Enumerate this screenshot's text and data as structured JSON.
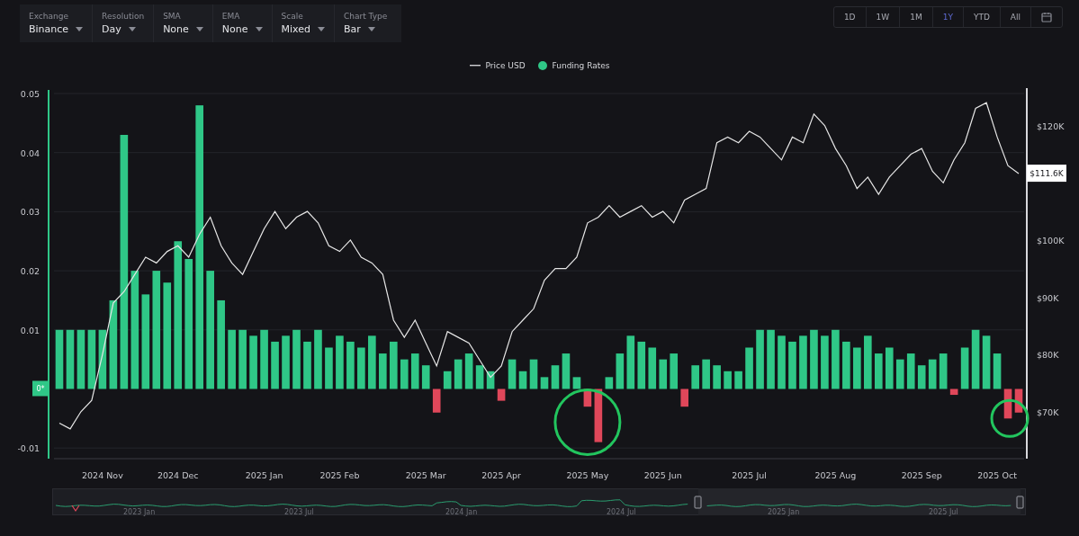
{
  "toolbar": {
    "selectors": [
      {
        "label": "Exchange",
        "value": "Binance"
      },
      {
        "label": "Resolution",
        "value": "Day"
      },
      {
        "label": "SMA",
        "value": "None"
      },
      {
        "label": "EMA",
        "value": "None"
      },
      {
        "label": "Scale",
        "value": "Mixed"
      },
      {
        "label": "Chart Type",
        "value": "Bar"
      }
    ]
  },
  "range_buttons": [
    {
      "label": "1D",
      "selected": false
    },
    {
      "label": "1W",
      "selected": false
    },
    {
      "label": "1M",
      "selected": false
    },
    {
      "label": "1Y",
      "selected": true
    },
    {
      "label": "YTD",
      "selected": false
    },
    {
      "label": "All",
      "selected": false
    }
  ],
  "chart": {
    "zero_badge": "0*",
    "price_tag": "$111.6K",
    "chart_data": {
      "type": "bar",
      "ylim": [
        -0.0118,
        0.05
      ],
      "y2lim": [
        61.8,
        125.6
      ],
      "yticks": [
        {
          "value": 0.05,
          "label": "0.05"
        },
        {
          "value": 0.04,
          "label": "0.04"
        },
        {
          "value": 0.03,
          "label": "0.03"
        },
        {
          "value": 0.02,
          "label": "0.02"
        },
        {
          "value": 0.01,
          "label": "0.01"
        },
        {
          "value": -0.01,
          "label": "-0.01"
        }
      ],
      "y2ticks": [
        {
          "value": 120,
          "label": "$120K"
        },
        {
          "value": 100,
          "label": "$100K"
        },
        {
          "value": 90,
          "label": "$90K"
        },
        {
          "value": 80,
          "label": "$80K"
        },
        {
          "value": 70,
          "label": "$70K"
        }
      ],
      "categories": [
        null,
        null,
        null,
        null,
        "2024 Nov",
        null,
        null,
        null,
        null,
        null,
        null,
        "2024 Dec",
        null,
        null,
        null,
        null,
        null,
        null,
        null,
        "2025 Jan",
        null,
        null,
        null,
        null,
        null,
        null,
        "2025 Feb",
        null,
        null,
        null,
        null,
        null,
        null,
        null,
        "2025 Mar",
        null,
        null,
        null,
        null,
        null,
        null,
        "2025 Apr",
        null,
        null,
        null,
        null,
        null,
        null,
        null,
        "2025 May",
        null,
        null,
        null,
        null,
        null,
        null,
        "2025 Jun",
        null,
        null,
        null,
        null,
        null,
        null,
        null,
        "2025 Jul",
        null,
        null,
        null,
        null,
        null,
        null,
        null,
        "2025 Aug",
        null,
        null,
        null,
        null,
        null,
        null,
        null,
        "2025 Sep",
        null,
        null,
        null,
        null,
        null,
        null,
        "2025 Oct",
        null,
        null
      ],
      "grid": true,
      "series": [
        {
          "name": "Price USD",
          "type": "line",
          "axis": "y2",
          "color": "#e6e6e6",
          "values": [
            68,
            67,
            70,
            72,
            80,
            89,
            91,
            94,
            97,
            96,
            98,
            99,
            97,
            101,
            104,
            99,
            96,
            94,
            98,
            102,
            105,
            102,
            104,
            105,
            103,
            99,
            98,
            100,
            97,
            96,
            94,
            86,
            83,
            86,
            82,
            78,
            84,
            83,
            82,
            79,
            76,
            78,
            84,
            86,
            88,
            93,
            95,
            95,
            97,
            103,
            104,
            106,
            104,
            105,
            106,
            104,
            105,
            103,
            107,
            108,
            109,
            117,
            118,
            117,
            119,
            118,
            116,
            114,
            118,
            117,
            122,
            120,
            116,
            113,
            109,
            111,
            108,
            111,
            113,
            115,
            116,
            112,
            110,
            114,
            117,
            123,
            124,
            118,
            113,
            111.6
          ]
        },
        {
          "name": "Funding Rates",
          "type": "bar",
          "color": "#2fc787",
          "colors": [
            "#2fc787",
            "#2fc787",
            "#2fc787",
            "#2fc787",
            "#2fc787",
            "#2fc787",
            "#2fc787",
            "#2fc787",
            "#2fc787",
            "#2fc787",
            "#2fc787",
            "#2fc787",
            "#2fc787",
            "#2fc787",
            "#2fc787",
            "#2fc787",
            "#2fc787",
            "#2fc787",
            "#2fc787",
            "#2fc787",
            "#2fc787",
            "#2fc787",
            "#2fc787",
            "#2fc787",
            "#2fc787",
            "#2fc787",
            "#2fc787",
            "#2fc787",
            "#2fc787",
            "#2fc787",
            "#2fc787",
            "#2fc787",
            "#2fc787",
            "#2fc787",
            "#2fc787",
            "#e0475a",
            "#2fc787",
            "#2fc787",
            "#2fc787",
            "#2fc787",
            "#2fc787",
            "#e0475a",
            "#2fc787",
            "#2fc787",
            "#2fc787",
            "#2fc787",
            "#2fc787",
            "#2fc787",
            "#2fc787",
            "#e0475a",
            "#e0475a",
            "#2fc787",
            "#2fc787",
            "#2fc787",
            "#2fc787",
            "#2fc787",
            "#2fc787",
            "#2fc787",
            "#e0475a",
            "#2fc787",
            "#2fc787",
            "#2fc787",
            "#2fc787",
            "#2fc787",
            "#2fc787",
            "#2fc787",
            "#2fc787",
            "#2fc787",
            "#2fc787",
            "#2fc787",
            "#2fc787",
            "#2fc787",
            "#2fc787",
            "#2fc787",
            "#2fc787",
            "#2fc787",
            "#2fc787",
            "#2fc787",
            "#2fc787",
            "#2fc787",
            "#2fc787",
            "#2fc787",
            "#2fc787",
            "#e0475a",
            "#2fc787",
            "#2fc787",
            "#2fc787",
            "#2fc787",
            "#e0475a",
            "#e0475a"
          ],
          "values": [
            0.01,
            0.01,
            0.01,
            0.01,
            0.01,
            0.015,
            0.043,
            0.02,
            0.016,
            0.02,
            0.018,
            0.025,
            0.022,
            0.048,
            0.02,
            0.015,
            0.01,
            0.01,
            0.009,
            0.01,
            0.008,
            0.009,
            0.01,
            0.008,
            0.01,
            0.007,
            0.009,
            0.008,
            0.007,
            0.009,
            0.006,
            0.008,
            0.005,
            0.006,
            0.004,
            -0.004,
            0.003,
            0.005,
            0.006,
            0.004,
            0.003,
            -0.002,
            0.005,
            0.003,
            0.005,
            0.002,
            0.004,
            0.006,
            0.002,
            -0.003,
            -0.009,
            0.002,
            0.006,
            0.009,
            0.008,
            0.007,
            0.005,
            0.006,
            -0.003,
            0.004,
            0.005,
            0.004,
            0.003,
            0.003,
            0.007,
            0.01,
            0.01,
            0.009,
            0.008,
            0.009,
            0.01,
            0.009,
            0.01,
            0.008,
            0.007,
            0.009,
            0.006,
            0.007,
            0.005,
            0.006,
            0.004,
            0.005,
            0.006,
            -0.001,
            0.007,
            0.01,
            0.009,
            0.006,
            -0.005,
            -0.004
          ]
        }
      ]
    }
  },
  "navigator": {
    "labels": [
      "2023 Jan",
      "2023 Jul",
      "2024 Jan",
      "2024 Jul",
      "2025 Jan",
      "2025 Jul"
    ]
  }
}
